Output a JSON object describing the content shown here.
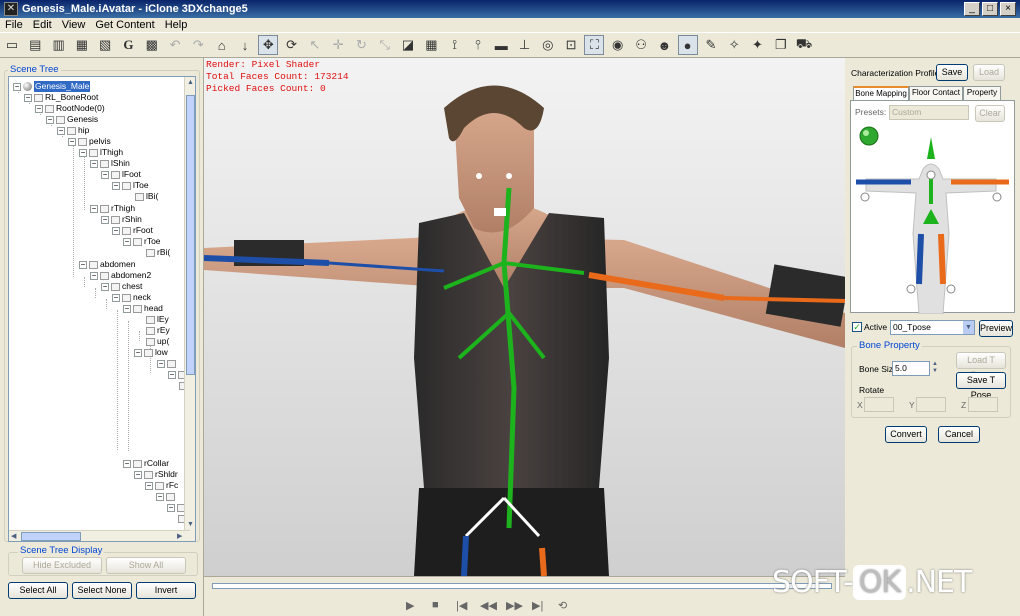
{
  "window": {
    "title": "Genesis_Male.iAvatar - iClone 3DXchange5",
    "buttons": [
      "_",
      "□",
      "×"
    ]
  },
  "menu": [
    "File",
    "Edit",
    "View",
    "Get Content",
    "Help"
  ],
  "toolbar": {
    "icons": [
      "open-file-icon",
      "import-icon",
      "import-fbx-icon",
      "export-icon",
      "export-fbx-icon",
      "g-icon",
      "texture-icon",
      "undo-icon",
      "redo-icon",
      "home-icon",
      "download-icon",
      "move-icon",
      "rotate-icon",
      "select-icon",
      "move-gizmo-icon",
      "rotate-gizmo-icon",
      "scale-gizmo-icon",
      "box-icon",
      "grid-icon",
      "bone-icon",
      "pin-icon",
      "plane-icon",
      "axis-icon",
      "globe-icon",
      "wire-icon",
      "camera-icon",
      "eye-icon",
      "skeleton-icon",
      "face-icon",
      "sphere-icon",
      "tool-icon",
      "pack-icon",
      "pack2-icon",
      "copy-icon",
      "cart-icon"
    ]
  },
  "left": {
    "scene_tree_label": "Scene Tree",
    "tree": [
      {
        "label": "Genesis_Male",
        "selected": true
      },
      {
        "label": "RL_BoneRoot"
      },
      {
        "label": "RootNode(0)"
      },
      {
        "label": "Genesis"
      },
      {
        "label": "hip"
      },
      {
        "label": "pelvis"
      },
      {
        "label": "lThigh"
      },
      {
        "label": "lShin"
      },
      {
        "label": "lFoot"
      },
      {
        "label": "lToe"
      },
      {
        "label": "lBi("
      },
      {
        "label": "rThigh"
      },
      {
        "label": "rShin"
      },
      {
        "label": "rFoot"
      },
      {
        "label": "rToe"
      },
      {
        "label": "rBi("
      },
      {
        "label": "abdomen"
      },
      {
        "label": "abdomen2"
      },
      {
        "label": "chest"
      },
      {
        "label": "neck"
      },
      {
        "label": "head"
      },
      {
        "label": "lEy"
      },
      {
        "label": "rEy"
      },
      {
        "label": "up("
      },
      {
        "label": "low"
      },
      {
        "label": "rCollar"
      },
      {
        "label": "rShldr"
      },
      {
        "label": "rFc"
      }
    ],
    "scene_tree_display_label": "Scene Tree Display",
    "hide_excluded": "Hide Excluded",
    "show_all": "Show All",
    "select_all": "Select All",
    "select_none": "Select None",
    "invert": "Invert"
  },
  "viewport": {
    "render": "Render: Pixel Shader",
    "total_faces": "Total Faces Count: 173214",
    "picked_faces": "Picked Faces Count: 0"
  },
  "right": {
    "profile_label": "Characterization Profile",
    "save": "Save",
    "load": "Load",
    "tabs": [
      "Bone Mapping",
      "Floor Contact",
      "Property"
    ],
    "presets_label": "Presets:",
    "presets_value": "Custom",
    "clear": "Clear",
    "active_label": "Active",
    "pose_value": "00_Tpose",
    "preview": "Preview",
    "bone_property_label": "Bone Property",
    "load_tpose": "Load T Pose",
    "bone_size_label": "Bone Size",
    "bone_size_value": "5.0",
    "save_tpose": "Save T Pose",
    "rotate_label": "Rotate",
    "x_label": "X",
    "y_label": "Y",
    "z_label": "Z",
    "convert": "Convert",
    "cancel": "Cancel"
  },
  "timeline": {
    "controls": [
      "▶",
      "■",
      "|◀",
      "◀◀",
      "▶▶",
      "▶|",
      "⟲"
    ]
  },
  "watermark": {
    "left": "SOFT-",
    "ok": "OK",
    "right": ".NET"
  }
}
